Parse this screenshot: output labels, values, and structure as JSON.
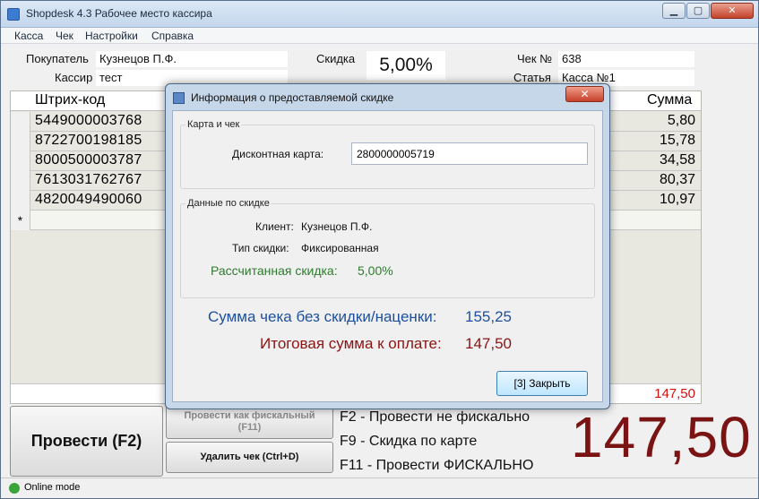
{
  "window": {
    "title": "Shopdesk 4.3 Рабочее место кассира",
    "min_glyph": "▁",
    "max_glyph": "▢",
    "close_glyph": "✕"
  },
  "menu": [
    "Касса",
    "Чек",
    "Настройки",
    "Справка"
  ],
  "header": {
    "buyer_label": "Покупатель",
    "buyer_value": "Кузнецов П.Ф.",
    "cashier_label": "Кассир",
    "cashier_value": "тест",
    "discount_label": "Скидка",
    "discount_value": "5,00%",
    "check_label": "Чек №",
    "check_value": "638",
    "article_label": "Статья",
    "article_value": "Касса №1"
  },
  "grid": {
    "col_barcode": "Штрих-код",
    "col_sum": "Сумма",
    "new_row_marker": "*",
    "rows": [
      {
        "barcode": "5449000003768",
        "sum": "5,80"
      },
      {
        "barcode": "8722700198185",
        "sum": "15,78"
      },
      {
        "barcode": "8000500003787",
        "sum": "34,58"
      },
      {
        "barcode": "7613031762767",
        "sum": "80,37"
      },
      {
        "barcode": "4820049490060",
        "sum": "10,97"
      }
    ],
    "total": "147,50"
  },
  "buttons": {
    "post": "Провести (F2)",
    "fiscal": "Провести как фискальный (F11)",
    "delete": "Удалить чек (Ctrl+D)"
  },
  "fkeys": [
    "F2 - Провести не фискально",
    "F9 - Скидка по карте",
    "F11 - Провести ФИСКАЛЬНО"
  ],
  "big_total": "147,50",
  "status": {
    "mode": "Online mode",
    "mode_color": "#3aa33a"
  },
  "dialog": {
    "title": "Информация о предоставляемой скидке",
    "close_glyph": "✕",
    "group_card": "Карта и чек",
    "card_label": "Дисконтная карта:",
    "card_value": "2800000005719",
    "group_discount": "Данные по скидке",
    "client_label": "Клиент:",
    "client_value": "Кузнецов П.Ф.",
    "type_label": "Тип скидки:",
    "type_value": "Фиксированная",
    "calc_label": "Рассчитанная скидка:",
    "calc_value": "5,00%",
    "sum_label": "Сумма чека без скидки/наценки:",
    "sum_value": "155,25",
    "total_label": "Итоговая сумма к оплате:",
    "total_value": "147,50",
    "close_button": "[3] Закрыть"
  }
}
